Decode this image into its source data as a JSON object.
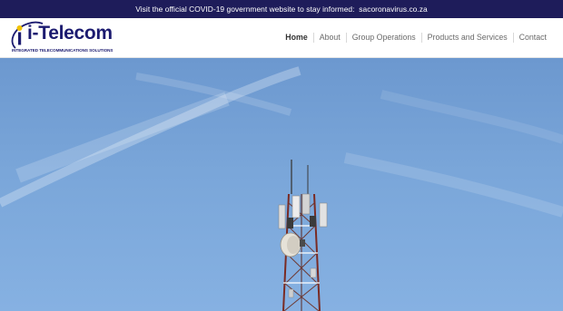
{
  "announcement": {
    "text": "Visit the official COVID-19 government website to stay informed:",
    "link": "sacoronavirus.co.za"
  },
  "logo": {
    "name": "i-Telecom",
    "tagline": "INTEGRATED TELECOMMUNICATIONS SOLUTIONS"
  },
  "nav": {
    "items": [
      {
        "label": "Home",
        "active": true
      },
      {
        "label": "About",
        "active": false
      },
      {
        "label": "Group Operations",
        "active": false
      },
      {
        "label": "Products and Services",
        "active": false
      },
      {
        "label": "Contact",
        "active": false
      }
    ]
  },
  "colors": {
    "topbar": "#1e1c5a",
    "brand": "#1c1b70",
    "accent": "#f2c200",
    "sky": "#7aa6d9"
  }
}
